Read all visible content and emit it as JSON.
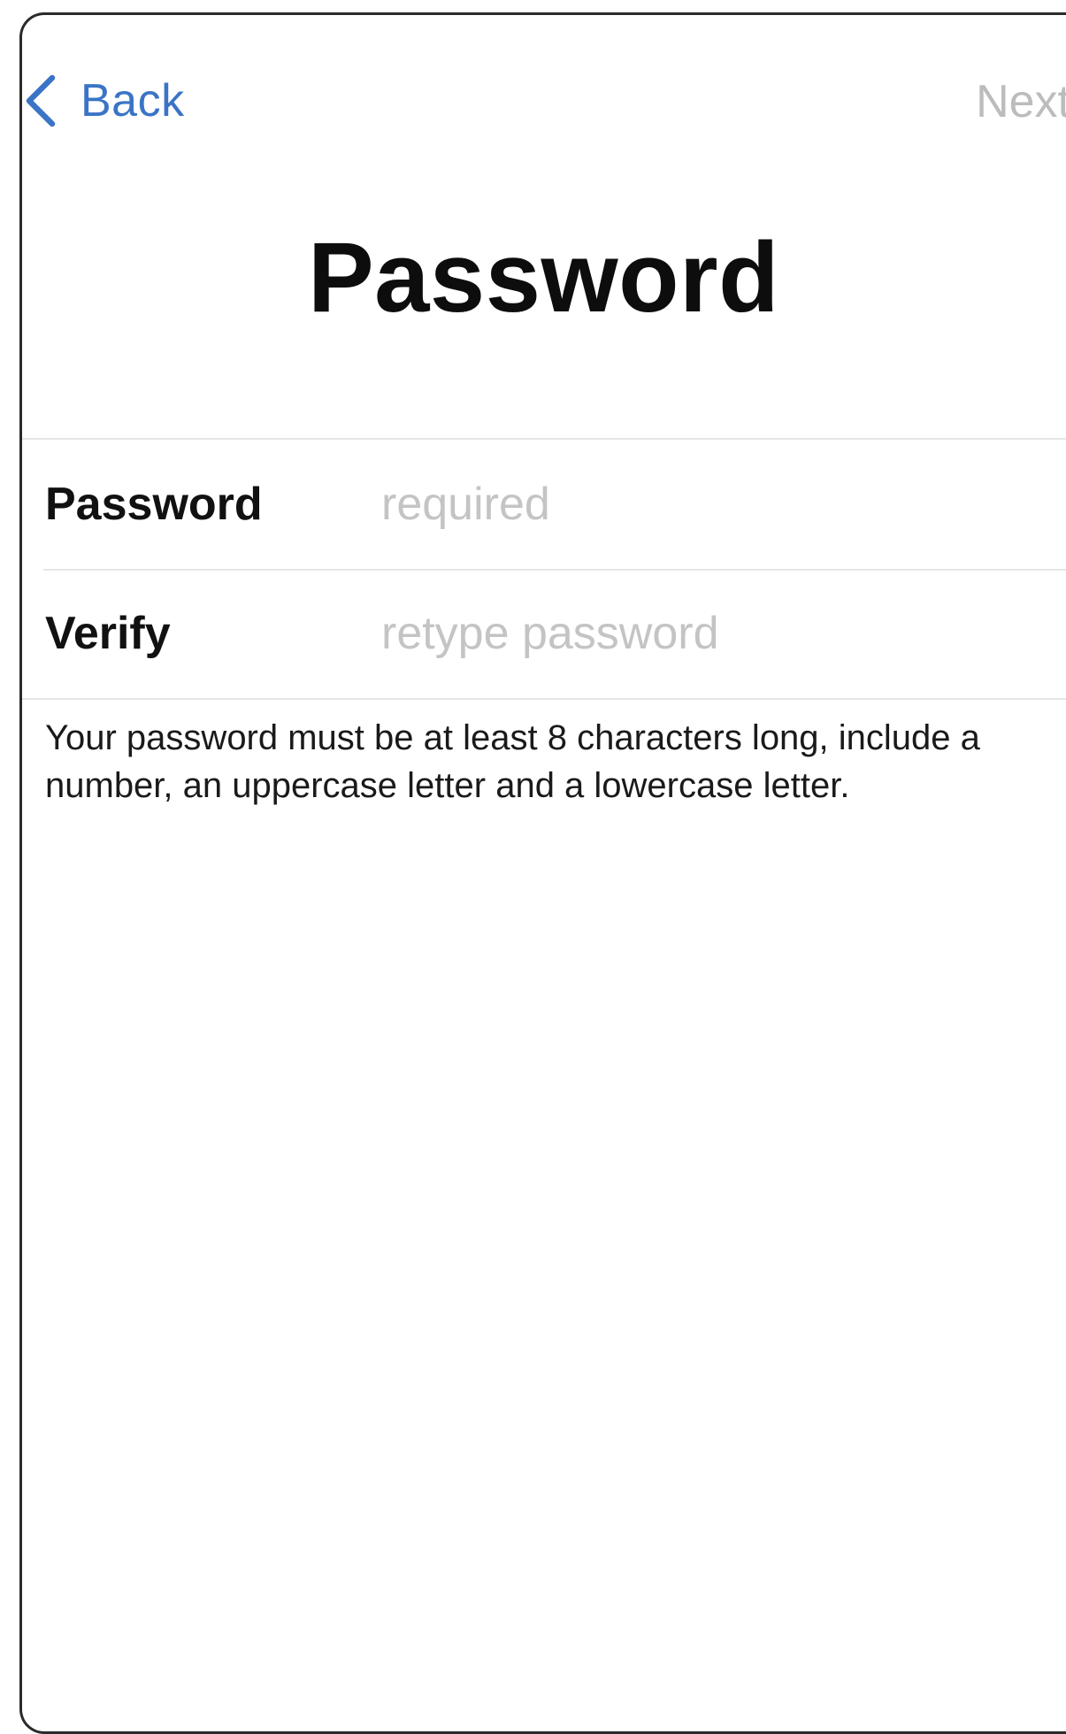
{
  "nav": {
    "back_label": "Back",
    "next_label": "Next"
  },
  "title": "Password",
  "form": {
    "password": {
      "label": "Password",
      "placeholder": "required",
      "value": ""
    },
    "verify": {
      "label": "Verify",
      "placeholder": "retype password",
      "value": ""
    }
  },
  "help_text": "Your password must be at least 8 characters long, include a number, an uppercase letter and a lowercase letter.",
  "icons": {
    "back": "chevron-left-icon"
  },
  "colors": {
    "accent": "#3a74c6",
    "disabled": "#bcbcbc",
    "placeholder": "#c4c4c4",
    "separator": "#e6e6e6"
  }
}
